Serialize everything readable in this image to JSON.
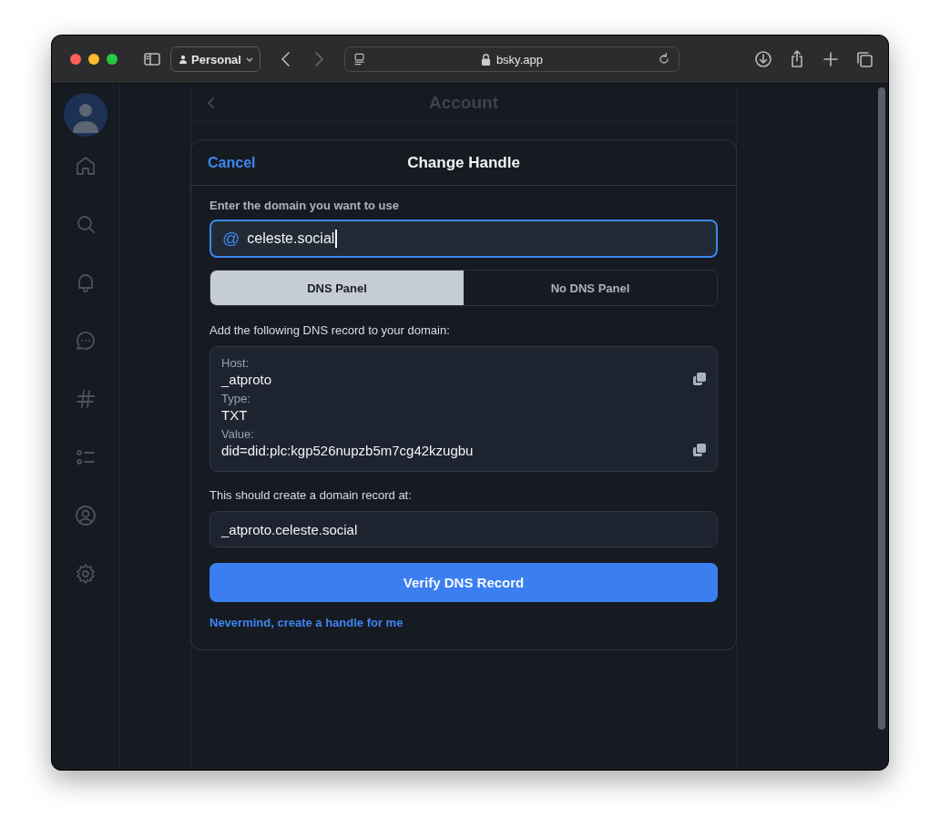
{
  "browser": {
    "profile": "Personal",
    "url": "bsky.app"
  },
  "page_header": {
    "title": "Account"
  },
  "dialog": {
    "cancel": "Cancel",
    "title": "Change Handle",
    "domain_label": "Enter the domain you want to use",
    "domain_input": {
      "prefix": "@",
      "value": "celeste.social"
    },
    "tabs": [
      {
        "label": "DNS Panel",
        "selected": true
      },
      {
        "label": "No DNS Panel",
        "selected": false
      }
    ],
    "instructions": "Add the following DNS record to your domain:",
    "record": [
      {
        "label": "Host:",
        "value": "_atproto",
        "copy": true
      },
      {
        "label": "Type:",
        "value": "TXT",
        "copy": false
      },
      {
        "label": "Value:",
        "value": "did=did:plc:kgp526nupzb5m7cg42kzugbu",
        "copy": true
      }
    ],
    "record_note": "This should create a domain record at:",
    "record_at": "_atproto.celeste.social",
    "verify_button": "Verify DNS Record",
    "fallback_link": "Nevermind, create a handle for me"
  }
}
